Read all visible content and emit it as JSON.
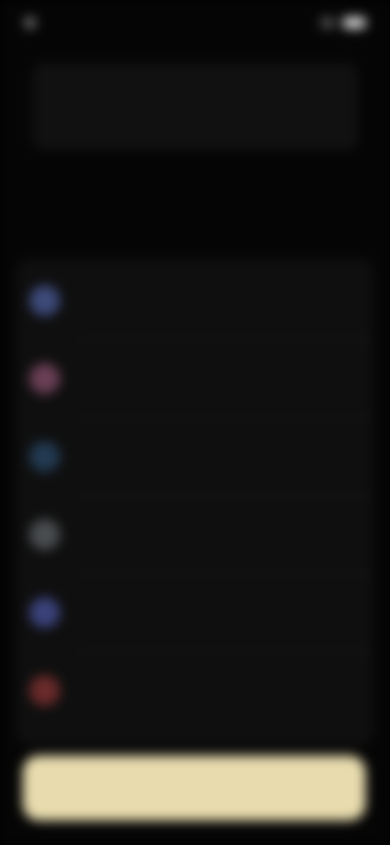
{
  "status_bar": {
    "time": "",
    "right_text": ""
  },
  "header": {
    "title": "",
    "subtitle": ""
  },
  "section": {
    "title": ""
  },
  "list": {
    "items": [
      {
        "label": "",
        "icon": "app-icon-blue",
        "icon_color": "#3d4a7a"
      },
      {
        "label": "",
        "icon": "app-icon-pink",
        "icon_color": "#6a3f55"
      },
      {
        "label": "",
        "icon": "app-icon-teal",
        "icon_color": "#223a52"
      },
      {
        "label": "",
        "icon": "app-icon-gray",
        "icon_color": "#4a4d50"
      },
      {
        "label": "",
        "icon": "app-icon-indigo",
        "icon_color": "#3a427a"
      },
      {
        "label": "",
        "icon": "app-icon-red",
        "icon_color": "#6a2a2a"
      }
    ]
  },
  "cta": {
    "label": ""
  },
  "colors": {
    "background": "#050505",
    "panel": "#0f0f0f",
    "accent": "#e8dcae"
  }
}
